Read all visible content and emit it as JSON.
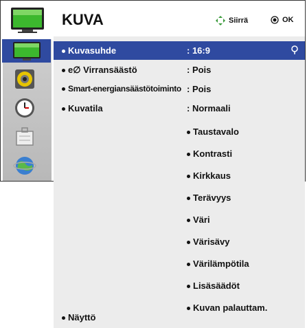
{
  "menu": {
    "title": "KUVA",
    "hint_move": "Siirrä",
    "hint_ok": "OK"
  },
  "side_icons": [
    "tv-icon",
    "speaker-icon",
    "clock-icon",
    "lock-icon",
    "globe-icon"
  ],
  "colors": {
    "selected_bg": "#2f4aa0",
    "panel_bg": "#ececec"
  },
  "rows": [
    {
      "label": "Kuvasuhde",
      "value": ": 16:9"
    },
    {
      "label": "e∅ Virransäästö",
      "value": ": Pois"
    },
    {
      "label": "Smart-energiansäästötoiminto",
      "value": ": Pois"
    },
    {
      "label": "Kuvatila",
      "value": ": Normaali"
    }
  ],
  "submenu": [
    "Taustavalo",
    "Kontrasti",
    "Kirkkaus",
    "Terävyys",
    "Väri",
    "Värisävy",
    "Värilämpötila",
    "Lisäsäädöt",
    "Kuvan palauttam."
  ],
  "bottom_item": "Näyttö"
}
